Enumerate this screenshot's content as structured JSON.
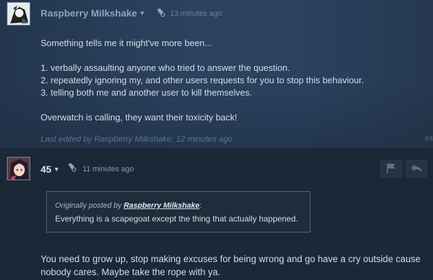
{
  "post1": {
    "author": "Raspberry Milkshake",
    "timestamp": "13 minutes ago",
    "lines": [
      "Something tells me it might've more been...",
      "1. verbally assaulting anyone who tried to answer the question.",
      "2. repeatedly ignoring my, and other users requests for you to stop this behaviour.",
      "3. telling both me and another user to kill themselves.",
      "Overwatch is calling, they want their toxicity back!"
    ],
    "edited": "Last edited by Raspberry Milkshake; 12 minutes ago",
    "post_number": "#4"
  },
  "post2": {
    "author": "45",
    "timestamp": "11 minutes ago",
    "quote": {
      "prefix": "Originally posted by",
      "author": "Raspberry Milkshake",
      "suffix": ":",
      "text": "Everything is a scapegoat except the thing that actually happened."
    },
    "body": "You need to grow up, stop making excuses for being wrong and go have a cry outside cause nobody cares. Maybe take the rope with ya."
  },
  "icons": {
    "award": "award-icon",
    "flag": "flag-icon",
    "reply": "reply-icon",
    "dropdown": "chevron-down-icon"
  },
  "colors": {
    "background": "#1b2838",
    "author_name": "#8ba6bf",
    "text": "#d6dde4"
  }
}
